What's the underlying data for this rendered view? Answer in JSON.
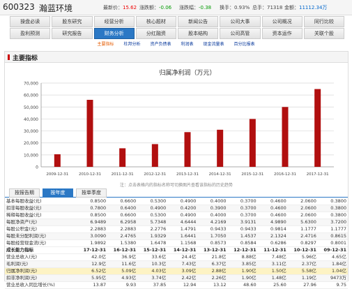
{
  "header": {
    "code": "600323",
    "name": "瀚蓝环境",
    "latest_label": "最新价：",
    "latest": "15.62",
    "change_label": "涨跌额：",
    "change": "-0.06",
    "pct_label": "涨跌幅：",
    "pct": "-0.38",
    "turnover_label": "换手：",
    "turnover": "0.93%",
    "volume_label": "总手：",
    "volume": "71318",
    "amount_label": "金额：",
    "amount": "11112.34万"
  },
  "nav": {
    "row1": [
      "操盘必读",
      "股东研究",
      "经营分析",
      "核心题材",
      "新闻公告",
      "公司大事",
      "公司概况",
      "同行比较"
    ],
    "row2": [
      "盈利预测",
      "研究报告",
      "财务分析",
      "分红融资",
      "股本结构",
      "公司高管",
      "资本运作",
      "关联个股"
    ],
    "active": "财务分析"
  },
  "subnav": {
    "items": [
      "主要指标",
      "杜邦分析",
      "资产负债表",
      "利润表",
      "现金流量表",
      "百分比报表"
    ],
    "active": "主要指标"
  },
  "panel": {
    "title": "主要指标"
  },
  "chart_data": {
    "type": "bar",
    "title": "归属净利润（万元）",
    "categories": [
      "2009-12-31",
      "2010-12-31",
      "2011-12-31",
      "2012-12-31",
      "2013-12-31",
      "2014-12-31",
      "2015-12-31",
      "2016-12-31",
      "2017-12-31"
    ],
    "values": [
      10500,
      56000,
      15500,
      19000,
      29000,
      31000,
      40000,
      50000,
      65000
    ],
    "ylim": [
      0,
      70000
    ],
    "yticks": [
      "0",
      "10,000",
      "20,000",
      "30,000",
      "40,000",
      "50,000",
      "60,000",
      "70,000"
    ],
    "color": "#b10f0f",
    "grid": true
  },
  "tip": "注：点击表格内的指标名称可切换图片查看该指标的历史趋势",
  "tabs": [
    "按报告期",
    "按年度",
    "按单季度"
  ],
  "active_tab": "按年度",
  "table": {
    "rows1": [
      {
        "label": "基本每股收益(元)",
        "values": [
          "0.8500",
          "0.6600",
          "0.5300",
          "0.4900",
          "0.4000",
          "0.3700",
          "0.4600",
          "2.0600",
          "0.3800"
        ]
      },
      {
        "label": "扣非每股收益(元)",
        "values": [
          "0.7800",
          "0.6400",
          "0.4900",
          "0.4200",
          "0.3900",
          "0.3700",
          "0.4600",
          "2.0600",
          "0.3800"
        ]
      },
      {
        "label": "稀释每股收益(元)",
        "values": [
          "0.8500",
          "0.6600",
          "0.5300",
          "0.4900",
          "0.4000",
          "0.3700",
          "0.4600",
          "2.0600",
          "0.3800"
        ]
      },
      {
        "label": "每股净资产(元)",
        "values": [
          "6.9489",
          "6.2958",
          "5.7348",
          "4.6444",
          "4.2169",
          "3.9131",
          "4.9890",
          "5.6300",
          "3.7200"
        ]
      },
      {
        "label": "每股公积金(元)",
        "values": [
          "2.2883",
          "2.2883",
          "2.2776",
          "1.4791",
          "0.9433",
          "0.9433",
          "0.9814",
          "1.1777",
          "1.1777"
        ]
      },
      {
        "label": "每股未分配利润(元)",
        "values": [
          "3.0090",
          "2.4765",
          "1.9329",
          "1.6441",
          "1.7050",
          "1.4537",
          "2.1324",
          "2.4716",
          "0.8615"
        ]
      },
      {
        "label": "每股经营现金流(元)",
        "values": [
          "1.9892",
          "1.5380",
          "1.6478",
          "1.1568",
          "0.8573",
          "0.8584",
          "0.6286",
          "0.8297",
          "0.8001"
        ]
      }
    ],
    "section_label": "成长能力指标",
    "years": [
      "17-12-31",
      "16-12-31",
      "15-12-31",
      "14-12-31",
      "13-12-31",
      "12-12-31",
      "11-12-31",
      "10-12-31",
      "09-12-31"
    ],
    "rows2": [
      {
        "label": "营业总收入(元)",
        "values": [
          "42.0亿",
          "36.9亿",
          "33.6亿",
          "24.4亿",
          "21.8亿",
          "8.88亿",
          "7.48亿",
          "5.96亿",
          "4.65亿"
        ]
      },
      {
        "label": "毛利润(元)",
        "values": [
          "12.9亿",
          "11.6亿",
          "10.3亿",
          "7.43亿",
          "6.37亿",
          "3.85亿",
          "3.11亿",
          "2.37亿",
          "1.84亿"
        ]
      },
      {
        "label": "归属净利润(元)",
        "values": [
          "6.52亿",
          "5.09亿",
          "4.03亿",
          "3.09亿",
          "2.88亿",
          "1.90亿",
          "1.50亿",
          "5.58亿",
          "1.04亿"
        ]
      },
      {
        "label": "扣非净利润(元)",
        "values": [
          "5.95亿",
          "4.93亿",
          "3.74亿",
          "2.42亿",
          "2.26亿",
          "1.90亿",
          "1.48亿",
          "1.19亿",
          "9473万"
        ]
      },
      {
        "label": "营业总收入同比增长(%)",
        "values": [
          "13.87",
          "9.93",
          "37.85",
          "12.94",
          "13.12",
          "48.60",
          "25.60",
          "27.96",
          "9.75"
        ]
      }
    ]
  }
}
